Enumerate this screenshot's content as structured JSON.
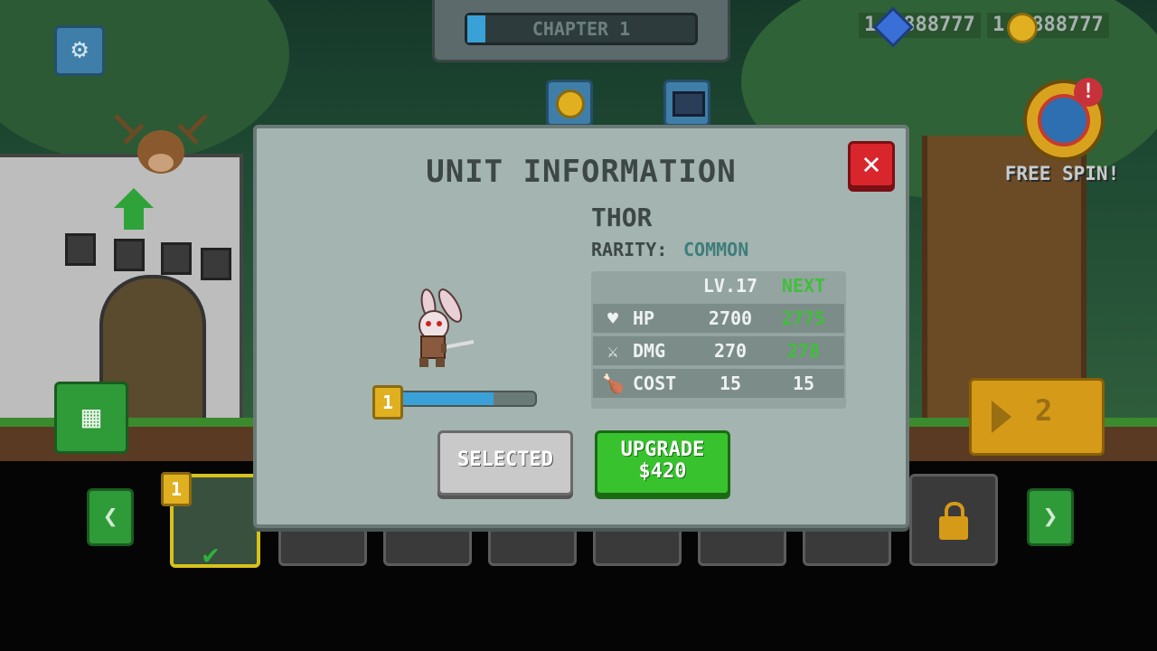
{
  "hud": {
    "chapter_label": "CHAPTER 1",
    "chapter_progress": 0.08,
    "gems_value": "1⬦888777",
    "gems_text": "1",
    "gems_rest": "888777",
    "coins_text": "1",
    "coins_rest": "888777",
    "free_spin_label": "FREE SPIN!",
    "alert_mark": "!",
    "play_count": "2"
  },
  "modal": {
    "title": "UNIT INFORMATION",
    "close_glyph": "✕",
    "unit_name": "THOR",
    "rarity_label": "RARITY:",
    "rarity_value": "COMMON",
    "level_badge": "1",
    "xp_progress": 0.69,
    "stats_header": {
      "current": "LV.17",
      "next": "NEXT"
    },
    "stats": [
      {
        "icon": "heart-icon",
        "glyph": "♥",
        "label": "HP",
        "current": "2700",
        "next": "2775",
        "changed": true
      },
      {
        "icon": "sword-icon",
        "glyph": "⚔",
        "label": "DMG",
        "current": "270",
        "next": "278",
        "changed": true
      },
      {
        "icon": "meat-icon",
        "glyph": "🍗",
        "label": "COST",
        "current": "15",
        "next": "15",
        "changed": false
      }
    ],
    "selected_label": "SELECTED",
    "upgrade_label": "UPGRADE",
    "upgrade_price": "$420"
  },
  "bottom_bar": {
    "prev_glyph": "❮",
    "next_glyph": "❯",
    "slot_badge": "1",
    "check_glyph": "✔"
  },
  "colors": {
    "modal_bg": "#a4b4b0",
    "upgrade_green": "#38c22e",
    "close_red": "#d9262c",
    "next_green": "#3fbf3a",
    "rarity_teal": "#3e7d7a"
  }
}
